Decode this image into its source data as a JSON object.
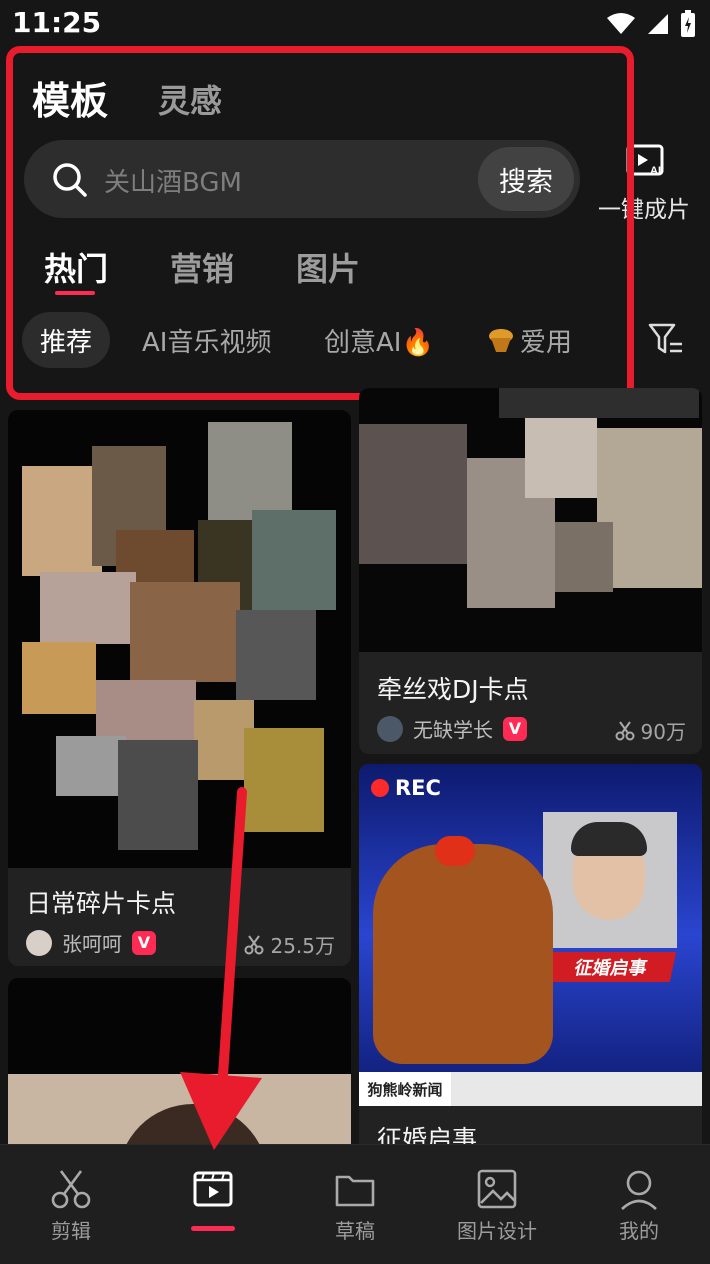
{
  "status_bar": {
    "time": "11:25"
  },
  "header": {
    "tab_template": "模板",
    "tab_inspiration": "灵感",
    "search_placeholder": "关山酒BGM",
    "search_button": "搜索",
    "quick_make_label": "一键成片"
  },
  "categories": [
    "热门",
    "营销",
    "图片"
  ],
  "chips": [
    "推荐",
    "AI音乐视频",
    "创意AI🔥",
    "爱用"
  ],
  "cards": [
    {
      "title": "日常碎片卡点",
      "author": "张呵呵",
      "usage": "25.5万"
    },
    {
      "title": "牵丝戏DJ卡点",
      "author": "无缺学长",
      "usage": "90万"
    },
    {
      "title": "征婚启事",
      "rec_label": "REC",
      "banner_text": "征婚启事",
      "ticker_text": "狗熊岭新闻"
    }
  ],
  "bottom_nav": [
    "剪辑",
    "模板",
    "草稿",
    "图片设计",
    "我的"
  ],
  "colors": {
    "accent": "#fe2c55",
    "annotation_red": "#e81c2c",
    "background": "#161616"
  }
}
